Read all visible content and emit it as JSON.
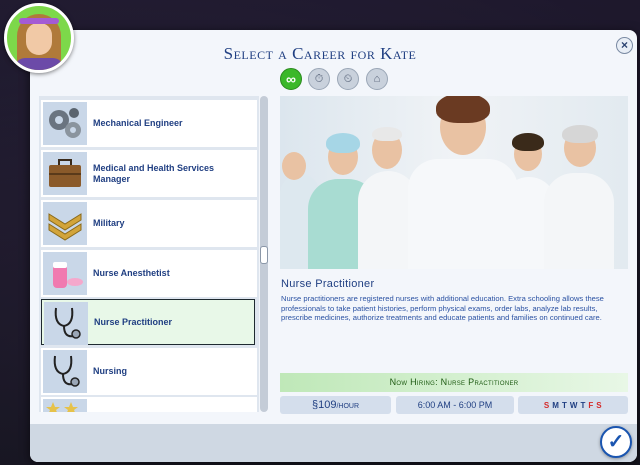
{
  "dialog": {
    "title": "Select a Career for Kate",
    "close_label": "×",
    "confirm_label": "✓"
  },
  "filters": [
    {
      "icon": "infinity-icon",
      "label": "∞",
      "active": true
    },
    {
      "icon": "briefcase-clock-icon",
      "label": "⏱",
      "active": false
    },
    {
      "icon": "briefcase-clock-alt-icon",
      "label": "⏲",
      "active": false
    },
    {
      "icon": "briefcase-house-icon",
      "label": "⌂",
      "active": false
    }
  ],
  "careers": [
    {
      "label": "Mechanical Engineer",
      "icon": "gears-icon"
    },
    {
      "label": "Medical and Health Services Manager",
      "icon": "briefcase-icon"
    },
    {
      "label": "Military",
      "icon": "military-chevron-icon"
    },
    {
      "label": "Nurse Anesthetist",
      "icon": "pills-icon"
    },
    {
      "label": "Nurse Practitioner",
      "icon": "stethoscope-icon",
      "selected": true
    },
    {
      "label": "Nursing",
      "icon": "stethoscope-icon"
    },
    {
      "label": "",
      "icon": "stars-icon"
    }
  ],
  "detail": {
    "name": "Nurse Practitioner",
    "description": "Nurse practitioners are registered nurses with additional education. Extra schooling allows these professionals to take patient histories, perform physical exams, order labs, analyze lab results, prescribe medicines, authorize treatments and educate patients and families on continued care.",
    "hiring": "Now Hiring: Nurse Practitioner",
    "pay_symbol": "§",
    "pay_amount": "109",
    "pay_unit": "/HOUR",
    "hours": "6:00 AM - 6:00 PM",
    "days": [
      {
        "d": "S",
        "work": false
      },
      {
        "d": "M",
        "work": true
      },
      {
        "d": "T",
        "work": true
      },
      {
        "d": "W",
        "work": true
      },
      {
        "d": "T",
        "work": true
      },
      {
        "d": "F",
        "work": false
      },
      {
        "d": "S",
        "work": false
      }
    ]
  },
  "colors": {
    "work_day": "#203f82",
    "off_day": "#d42a2a",
    "accent": "#203f82",
    "hiring_text": "#1d5a12"
  }
}
